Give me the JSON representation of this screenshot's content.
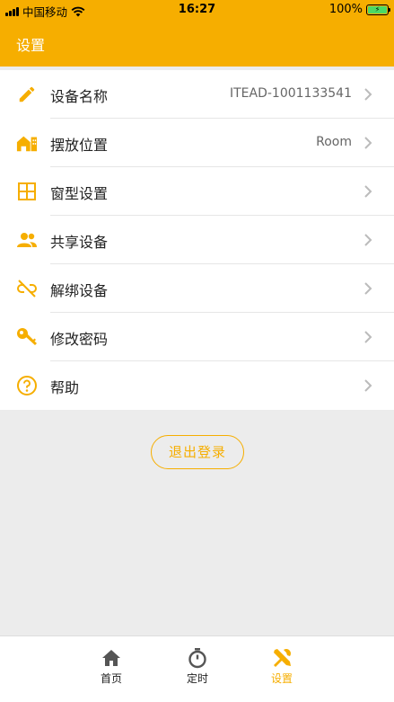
{
  "status_bar": {
    "carrier": "中国移动",
    "time": "16:27",
    "battery": "100%"
  },
  "header": {
    "title": "设置"
  },
  "menu": [
    {
      "label": "设备名称",
      "value": "ITEAD-1001133541",
      "icon": "pencil-icon"
    },
    {
      "label": "摆放位置",
      "value": "Room",
      "icon": "house-location-icon"
    },
    {
      "label": "窗型设置",
      "value": "",
      "icon": "window-icon"
    },
    {
      "label": "共享设备",
      "value": "",
      "icon": "people-icon"
    },
    {
      "label": "解绑设备",
      "value": "",
      "icon": "unlink-icon"
    },
    {
      "label": "修改密码",
      "value": "",
      "icon": "key-icon"
    },
    {
      "label": "帮助",
      "value": "",
      "icon": "help-icon"
    }
  ],
  "logout_label": "退出登录",
  "tabbar": {
    "tabs": [
      {
        "label": "首页",
        "icon": "home-icon",
        "active": false
      },
      {
        "label": "定时",
        "icon": "timer-icon",
        "active": false
      },
      {
        "label": "设置",
        "icon": "tools-icon",
        "active": true
      }
    ]
  },
  "colors": {
    "accent": "#f6ae00",
    "background": "#ececec",
    "battery": "#4cd964"
  }
}
